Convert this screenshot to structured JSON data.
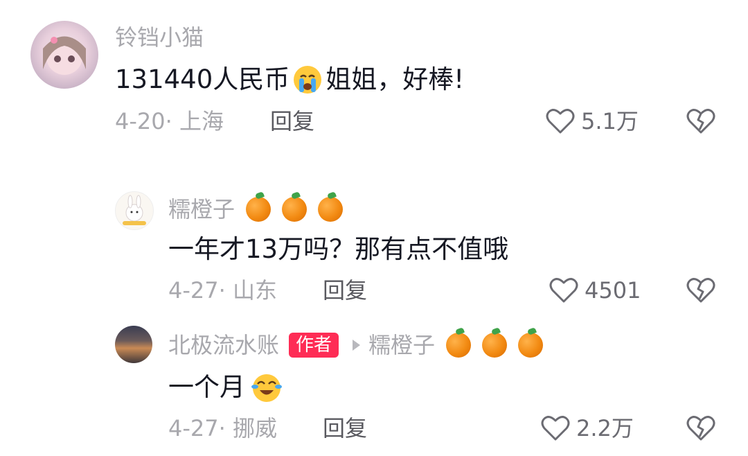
{
  "comments": [
    {
      "username": "铃铛小猫",
      "text_before_emoji": "131440人民币",
      "emoji": "crying-face-emoji",
      "text_after_emoji": "姐姐，好棒!",
      "date_location": "4-20· 上海",
      "reply_label": "回复",
      "likes": "5.1万"
    },
    {
      "username": "糯橙子",
      "name_emojis": [
        "orange-emoji",
        "orange-emoji",
        "orange-emoji"
      ],
      "text": "一年才13万吗？那有点不值哦",
      "date_location": "4-27· 山东",
      "reply_label": "回复",
      "likes": "4501"
    },
    {
      "username": "北极流水账",
      "author_tag": "作者",
      "reply_to": "糯橙子",
      "text": "一个月",
      "emoji": "laughing-tears-emoji",
      "date_location": "4-27· 挪威",
      "reply_label": "回复",
      "likes": "2.2万"
    }
  ],
  "colors": {
    "name": "#a8a8ad",
    "content": "#161823",
    "author_tag_bg": "#fe2c55"
  }
}
